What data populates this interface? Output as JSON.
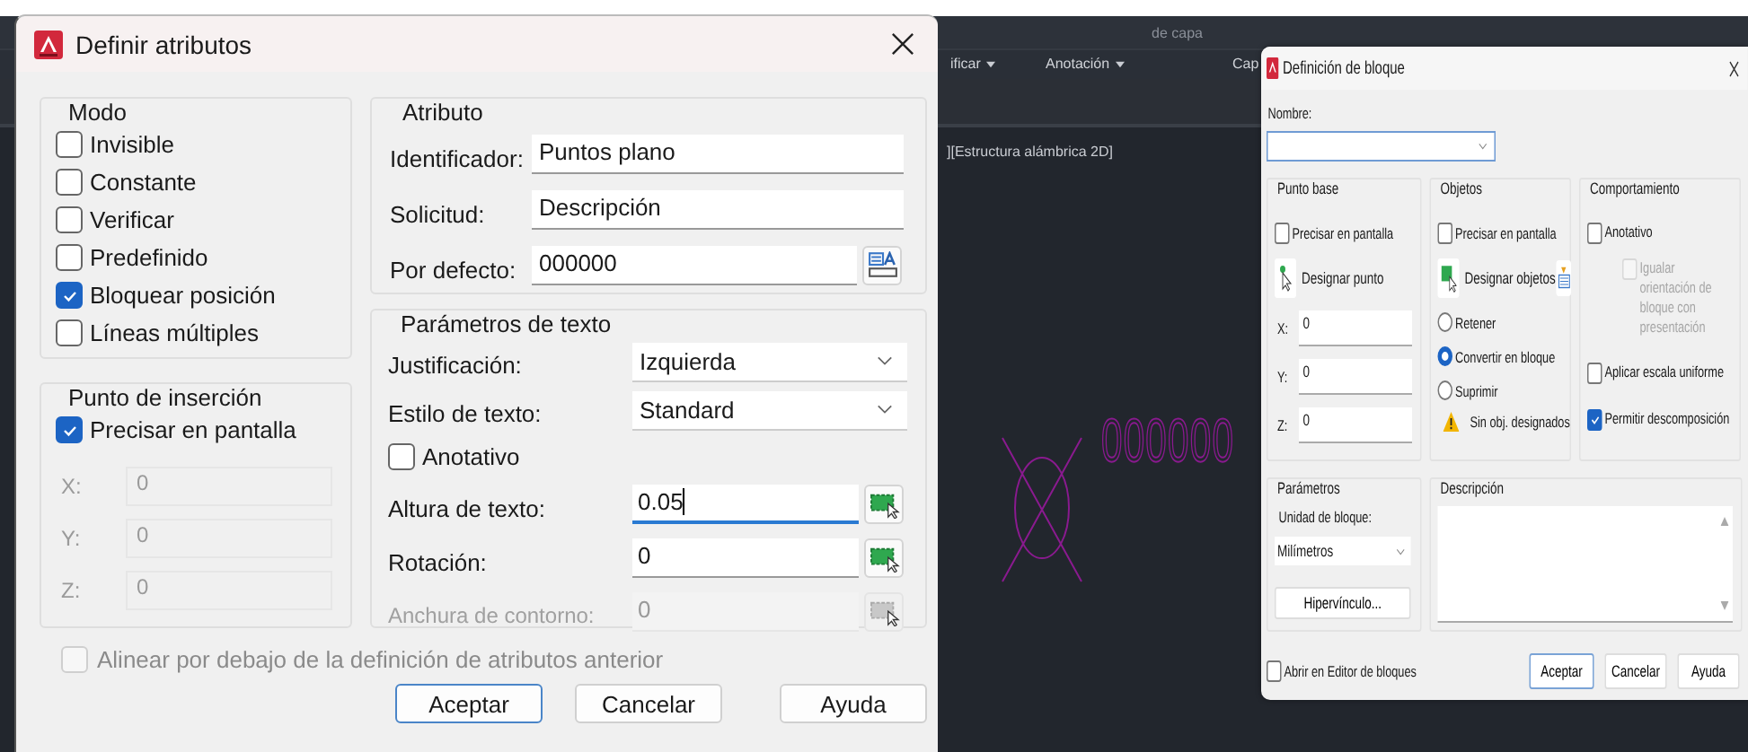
{
  "background_app": {
    "ribbon_top_label": "de capa",
    "panel_titles": [
      {
        "label": "ificar"
      },
      {
        "label": "Anotación"
      },
      {
        "label": "Cap"
      }
    ],
    "viewport_label": "][Estructura alámbrica 2D]",
    "drawing_text": "000000"
  },
  "attribute_dialog": {
    "title": "Definir atributos",
    "mode": {
      "title": "Modo",
      "options": [
        {
          "label": "Invisible",
          "checked": false
        },
        {
          "label": "Constante",
          "checked": false
        },
        {
          "label": "Verificar",
          "checked": false
        },
        {
          "label": "Predefinido",
          "checked": false
        },
        {
          "label": "Bloquear posición",
          "checked": true
        },
        {
          "label": "Líneas múltiples",
          "checked": false
        }
      ]
    },
    "insertion_point": {
      "title": "Punto de inserción",
      "specify_on_screen": {
        "label": "Precisar en pantalla",
        "checked": true
      },
      "coords": [
        {
          "label": "X:",
          "value": "0",
          "disabled": true
        },
        {
          "label": "Y:",
          "value": "0",
          "disabled": true
        },
        {
          "label": "Z:",
          "value": "0",
          "disabled": true
        }
      ]
    },
    "attribute": {
      "title": "Atributo",
      "fields": [
        {
          "kind": "text",
          "label": "Identificador:",
          "value": "Puntos plano"
        },
        {
          "kind": "text",
          "label": "Solicitud:",
          "value": "Descripción"
        },
        {
          "kind": "insert",
          "label": "Por defecto:",
          "value": "000000"
        }
      ]
    },
    "text_settings": {
      "title": "Parámetros de texto",
      "rows": [
        {
          "kind": "select",
          "label": "Justificación:",
          "value": "Izquierda"
        },
        {
          "kind": "select",
          "label": "Estilo de texto:",
          "value": "Standard"
        },
        {
          "kind": "checkbox",
          "label": "Anotativo",
          "checked": false
        },
        {
          "kind": "pick",
          "label": "Altura de texto:",
          "value": "0.05",
          "focused": true,
          "disabled": false
        },
        {
          "kind": "pick",
          "label": "Rotación:",
          "value": "0",
          "focused": false,
          "disabled": false
        },
        {
          "kind": "pick",
          "label": "Anchura de contorno:",
          "value": "0",
          "focused": false,
          "disabled": true
        }
      ]
    },
    "align_below": {
      "label": "Alinear por debajo de la definición de atributos anterior",
      "checked": false,
      "disabled": true
    },
    "buttons": [
      {
        "label": "Aceptar",
        "default": true
      },
      {
        "label": "Cancelar",
        "default": false
      },
      {
        "label": "Ayuda",
        "default": false
      }
    ]
  },
  "block_dialog": {
    "title": "Definición de bloque",
    "name_label": "Nombre:",
    "base_point": {
      "title": "Punto base",
      "specify_on_screen": {
        "label": "Precisar en pantalla",
        "checked": false
      },
      "pick_button": "Designar punto",
      "coords": [
        {
          "label": "X:",
          "value": "0"
        },
        {
          "label": "Y:",
          "value": "0"
        },
        {
          "label": "Z:",
          "value": "0"
        }
      ]
    },
    "objects": {
      "title": "Objetos",
      "specify_on_screen": {
        "label": "Precisar en pantalla",
        "checked": false
      },
      "select_button": "Designar objetos",
      "options": [
        {
          "label": "Retener",
          "selected": false
        },
        {
          "label": "Convertir en bloque",
          "selected": true
        },
        {
          "label": "Suprimir",
          "selected": false
        }
      ],
      "warning": "Sin obj. designados"
    },
    "behavior": {
      "title": "Comportamiento",
      "options": [
        {
          "kind": "main",
          "label": "Anotativo",
          "checked": false,
          "disabled": false
        },
        {
          "kind": "sub",
          "label": "Igualar orientación de bloque con presentación",
          "checked": false,
          "disabled": true
        },
        {
          "kind": "main",
          "label": "Aplicar escala uniforme",
          "checked": false,
          "disabled": false
        },
        {
          "kind": "main",
          "label": "Permitir descomposición",
          "checked": true,
          "disabled": false
        }
      ]
    },
    "settings": {
      "title": "Parámetros",
      "unit_label": "Unidad de bloque:",
      "unit": "Milímetros",
      "hyperlink_button": "Hipervínculo..."
    },
    "description": {
      "title": "Descripción"
    },
    "open_in_editor": {
      "label": "Abrir en Editor de bloques",
      "checked": false
    },
    "buttons": [
      {
        "label": "Aceptar",
        "default": true
      },
      {
        "label": "Cancelar",
        "default": false
      },
      {
        "label": "Ayuda",
        "default": false
      }
    ]
  }
}
